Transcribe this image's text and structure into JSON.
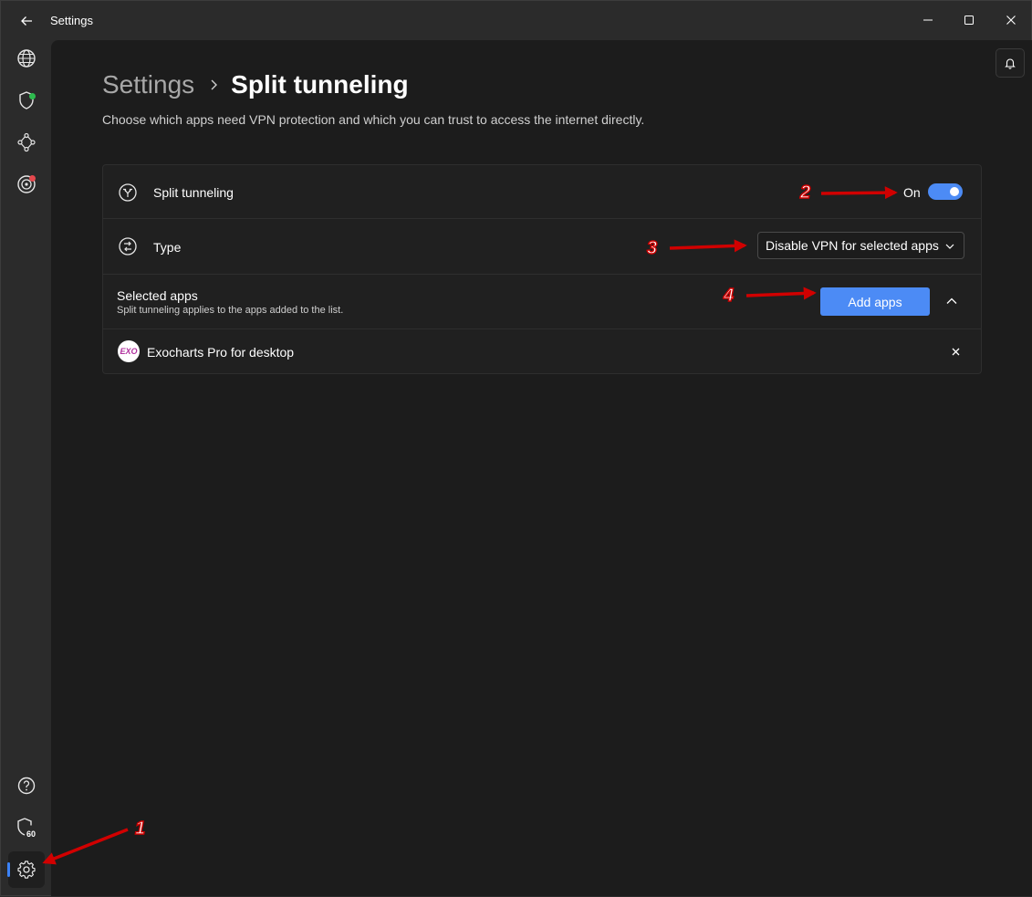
{
  "window": {
    "title": "Settings"
  },
  "breadcrumb": {
    "root": "Settings",
    "current": "Split tunneling"
  },
  "subtitle": "Choose which apps need VPN protection and which you can trust to access the internet directly.",
  "split_tunneling": {
    "label": "Split tunneling",
    "state_text": "On",
    "enabled": true
  },
  "type_row": {
    "label": "Type",
    "selected": "Disable VPN for selected apps"
  },
  "selected_apps": {
    "title": "Selected apps",
    "description": "Split tunneling applies to the apps added to the list.",
    "add_button": "Add apps",
    "apps": [
      {
        "name": "Exocharts Pro for desktop",
        "logo_text": "EXO"
      }
    ]
  },
  "rail": {
    "top": [
      "globe-icon",
      "shield-icon",
      "nodes-icon",
      "target-icon"
    ],
    "bottom": [
      "help-icon",
      "shield-timer-icon",
      "settings-icon"
    ],
    "shield_timer_badge": "60",
    "status_colors": {
      "connected": "#2dbb4e",
      "alert": "#e5484d"
    }
  },
  "annotations": [
    "1",
    "2",
    "3",
    "4"
  ],
  "colors": {
    "accent": "#4c8bf5",
    "annotation_red": "#d10000"
  }
}
